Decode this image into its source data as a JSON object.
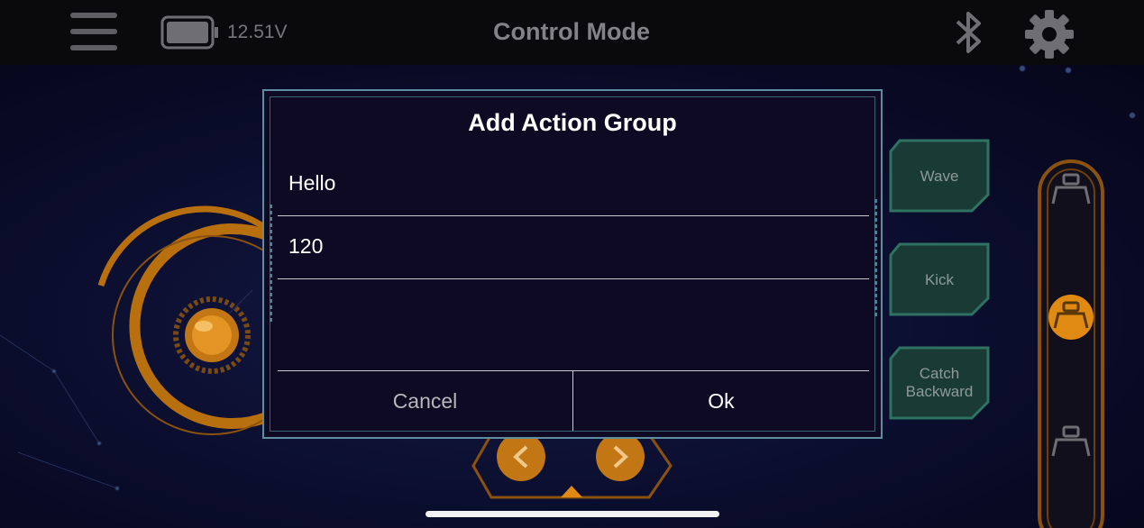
{
  "header": {
    "title": "Control Mode",
    "battery_voltage": "12.51V",
    "menu_icon": "hamburger-menu-icon",
    "bluetooth_icon": "bluetooth-icon",
    "settings_icon": "gear-icon"
  },
  "actions": [
    {
      "label": "Wave"
    },
    {
      "label": "Kick"
    },
    {
      "label": "Catch\nBackward"
    }
  ],
  "dialog": {
    "title": "Add Action Group",
    "name_value": "Hello",
    "number_value": "120",
    "cancel_label": "Cancel",
    "ok_label": "Ok"
  },
  "colors": {
    "accent_orange": "#e08a14",
    "teal_button": "#3f8b74",
    "dialog_border": "#5d8d9e",
    "dialog_bg": "#0e0a23"
  }
}
